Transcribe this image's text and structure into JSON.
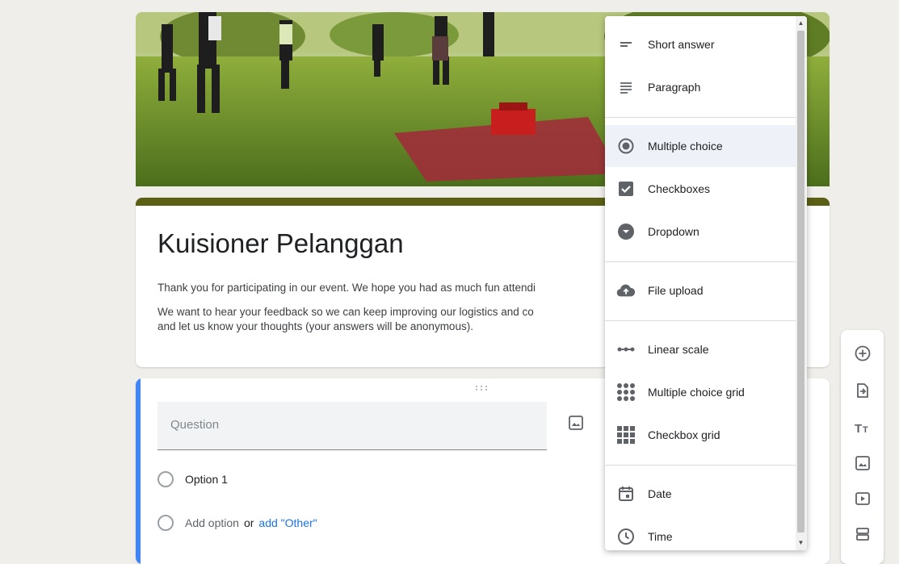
{
  "form": {
    "title": "Kuisioner Pelanggan",
    "description_1": "Thank you for participating in our event. We hope you had as much fun attendi",
    "description_2": "We want to hear your feedback so we can keep improving our logistics and co",
    "description_3": "and let us know your thoughts (your answers will be anonymous).",
    "accent_color": "#5a5f14"
  },
  "question": {
    "placeholder": "Question",
    "option_1": "Option 1",
    "add_option": "Add option",
    "or": "or",
    "add_other": "add \"Other\"",
    "accent_color": "#4285f4"
  },
  "menu": {
    "items": [
      {
        "label": "Short answer",
        "icon": "short-answer-icon"
      },
      {
        "label": "Paragraph",
        "icon": "paragraph-icon"
      },
      {
        "label": "Multiple choice",
        "icon": "radio-icon",
        "selected": true
      },
      {
        "label": "Checkboxes",
        "icon": "checkbox-icon"
      },
      {
        "label": "Dropdown",
        "icon": "dropdown-icon"
      },
      {
        "label": "File upload",
        "icon": "cloud-upload-icon"
      },
      {
        "label": "Linear scale",
        "icon": "linear-scale-icon"
      },
      {
        "label": "Multiple choice grid",
        "icon": "grid-icon"
      },
      {
        "label": "Checkbox grid",
        "icon": "checkbox-grid-icon"
      },
      {
        "label": "Date",
        "icon": "calendar-icon"
      },
      {
        "label": "Time",
        "icon": "clock-icon"
      }
    ]
  },
  "toolbar": {
    "tools": [
      "add-question-icon",
      "import-questions-icon",
      "add-title-icon",
      "add-image-icon",
      "add-video-icon",
      "add-section-icon"
    ]
  }
}
